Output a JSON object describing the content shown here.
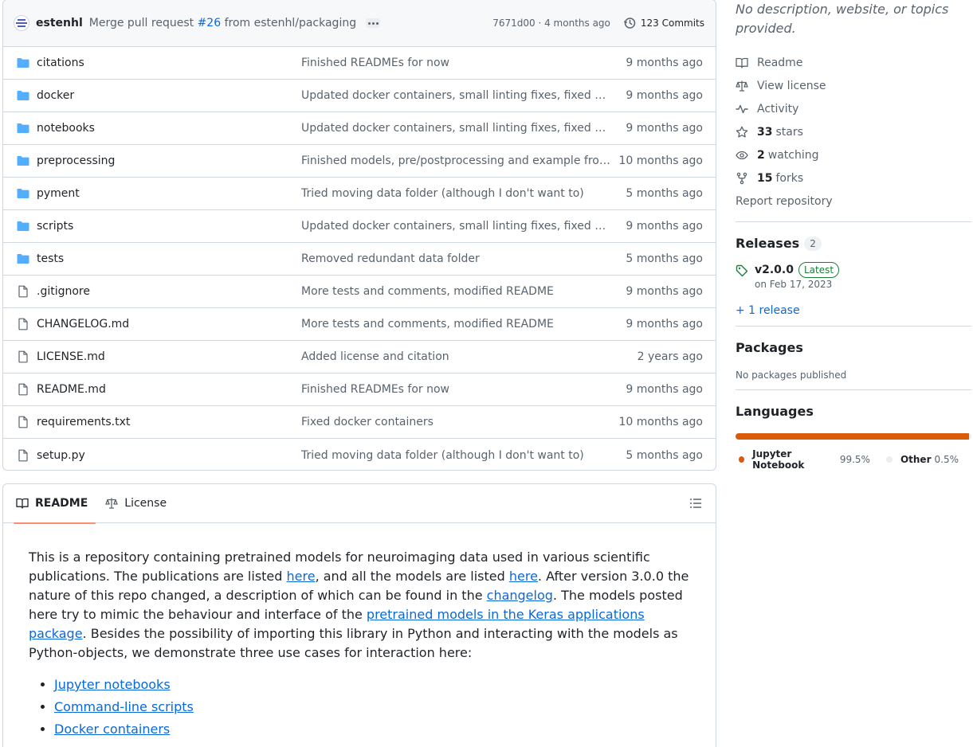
{
  "commit": {
    "author": "estenhl",
    "message_prefix": "Merge pull request",
    "pr": "#26",
    "message_suffix": "from estenhl/packaging",
    "meta": "7671d00 · 4 months ago",
    "commits_label": "123 Commits"
  },
  "files": [
    {
      "name": "citations",
      "type": "folder",
      "message": "Finished READMEs for now",
      "age": "9 months ago"
    },
    {
      "name": "docker",
      "type": "folder",
      "message": "Updated docker containers, small linting fixes, fixed bug ...",
      "age": "9 months ago"
    },
    {
      "name": "notebooks",
      "type": "folder",
      "message": "Updated docker containers, small linting fixes, fixed bug ...",
      "age": "9 months ago"
    },
    {
      "name": "preprocessing",
      "type": "folder",
      "message": "Finished models, pre/postprocessing and example from ...",
      "age": "10 months ago"
    },
    {
      "name": "pyment",
      "type": "folder",
      "message": "Tried moving data folder (although I don't want to)",
      "age": "5 months ago"
    },
    {
      "name": "scripts",
      "type": "folder",
      "message": "Updated docker containers, small linting fixes, fixed bug ...",
      "age": "9 months ago"
    },
    {
      "name": "tests",
      "type": "folder",
      "message": "Removed redundant data folder",
      "age": "5 months ago"
    },
    {
      "name": ".gitignore",
      "type": "file",
      "message": "More tests and comments, modified README",
      "age": "9 months ago"
    },
    {
      "name": "CHANGELOG.md",
      "type": "file",
      "message": "More tests and comments, modified README",
      "age": "9 months ago"
    },
    {
      "name": "LICENSE.md",
      "type": "file",
      "message": "Added license and citation",
      "age": "2 years ago"
    },
    {
      "name": "README.md",
      "type": "file",
      "message": "Finished READMEs for now",
      "age": "9 months ago"
    },
    {
      "name": "requirements.txt",
      "type": "file",
      "message": "Fixed docker containers",
      "age": "10 months ago"
    },
    {
      "name": "setup.py",
      "type": "file",
      "message": "Tried moving data folder (although I don't want to)",
      "age": "5 months ago"
    }
  ],
  "readme_tabs": {
    "readme": "README",
    "license": "License"
  },
  "readme": {
    "p1_a": "This is a repository containing pretrained models for neuroimaging data used in various scientific publications. The publications are listed ",
    "link_here1": "here",
    "p1_b": ", and all the models are listed ",
    "link_here2": "here",
    "p1_c": ". After version 3.0.0 the nature of this repo changed, a description of which can be found in the ",
    "link_changelog": "changelog",
    "p1_d": ". The models posted here try to mimic the behaviour and interface of the ",
    "link_keras": "pretrained models in the Keras applications package",
    "p1_e": ". Besides the possibility of importing this library in Python and interacting with the models as Python-objects, we demonstrate three use cases for interaction here:",
    "list": [
      "Jupyter notebooks",
      "Command-line scripts",
      "Docker containers"
    ]
  },
  "sidebar": {
    "description": "No description, website, or topics provided.",
    "links": {
      "readme": "Readme",
      "license": "View license",
      "activity": "Activity",
      "stars_count": "33",
      "stars_label": "stars",
      "watching_count": "2",
      "watching_label": "watching",
      "forks_count": "15",
      "forks_label": "forks"
    },
    "report": "Report repository",
    "releases": {
      "title": "Releases",
      "count": "2",
      "name": "v2.0.0",
      "badge": "Latest",
      "date": "on Feb 17, 2023",
      "more": "+ 1 release"
    },
    "packages": {
      "title": "Packages",
      "none": "No packages published"
    },
    "languages": {
      "title": "Languages",
      "items": [
        {
          "name": "Jupyter Notebook",
          "pct": "99.5%",
          "fraction": 0.995,
          "color": "#DA5B0B"
        },
        {
          "name": "Other",
          "pct": "0.5%",
          "fraction": 0.005,
          "color": "#ededed"
        }
      ]
    }
  },
  "colors": {
    "folder": "#54aeff",
    "link": "#0969da",
    "muted": "#59636e",
    "tab_underline": "#fd8c73",
    "latest": "#1a7f37"
  }
}
